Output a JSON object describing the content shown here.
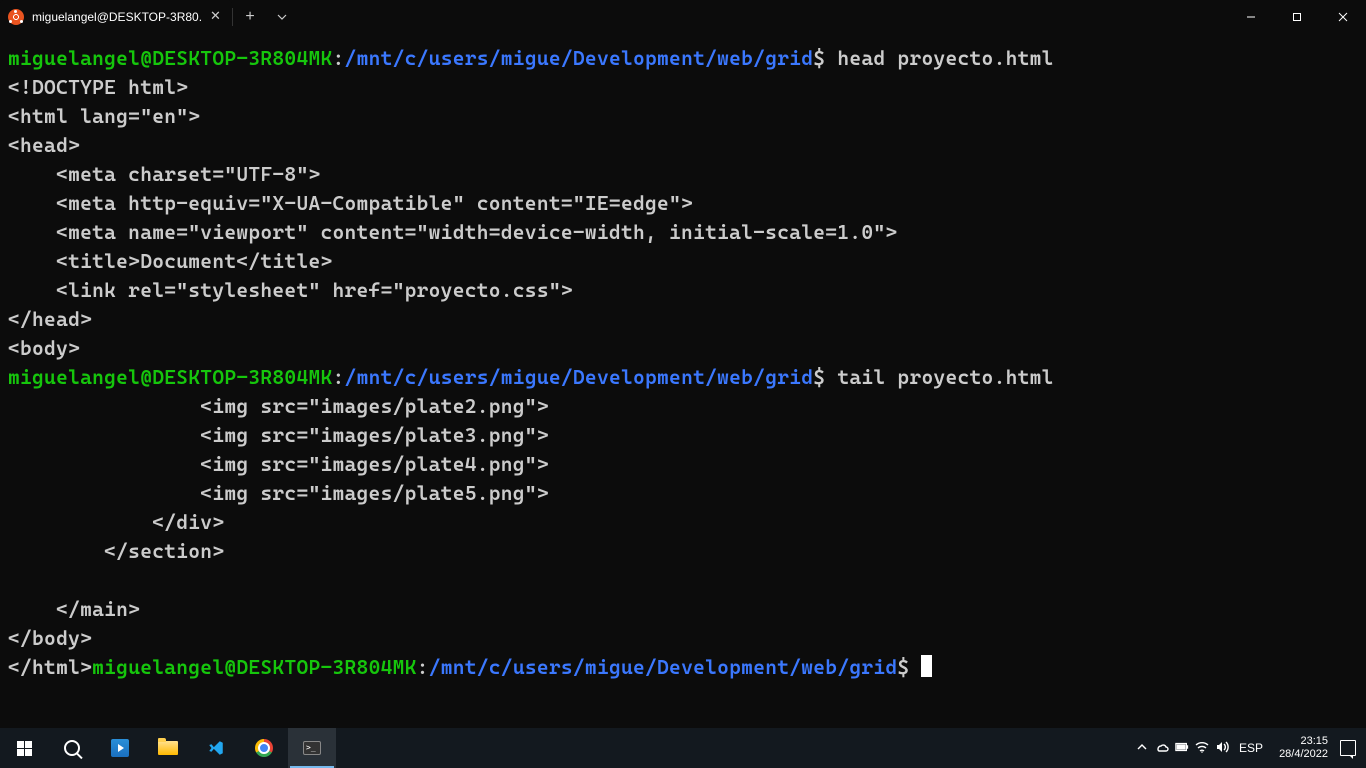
{
  "titlebar": {
    "tab_title": "miguelangel@DESKTOP-3R80..."
  },
  "terminal": {
    "prompt_user": "miguelangel@DESKTOP-3R804MK",
    "prompt_colon": ":",
    "prompt_path": "/mnt/c/users/migue/Development/web/grid",
    "prompt_dollar": "$",
    "cmd1": " head proyecto.html",
    "head_output": "<!DOCTYPE html>\n<html lang=\"en\">\n<head>\n    <meta charset=\"UTF-8\">\n    <meta http-equiv=\"X-UA-Compatible\" content=\"IE=edge\">\n    <meta name=\"viewport\" content=\"width=device-width, initial-scale=1.0\">\n    <title>Document</title>\n    <link rel=\"stylesheet\" href=\"proyecto.css\">\n</head>\n<body>",
    "cmd2": " tail proyecto.html",
    "tail_output": "                <img src=\"images/plate2.png\">\n                <img src=\"images/plate3.png\">\n                <img src=\"images/plate4.png\">\n                <img src=\"images/plate5.png\">\n            </div>\n        </section>\n\n    </main>\n</body>\n</html>"
  },
  "taskbar": {
    "lang": "ESP",
    "time": "23:15",
    "date": "28/4/2022"
  }
}
